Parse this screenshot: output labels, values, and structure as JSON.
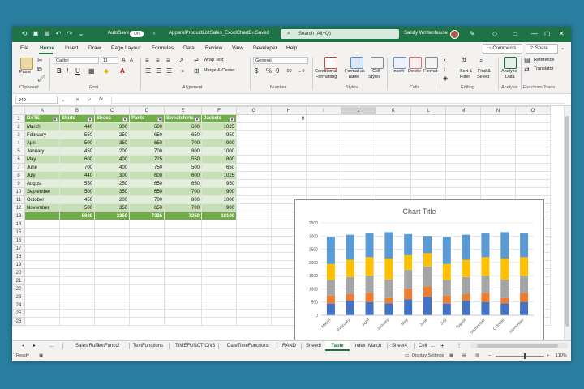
{
  "title_bar": {
    "autosave_label": "AutoSave",
    "autosave_state": "On",
    "doc_title": "ApparelProductListSales_ExcelChartD...",
    "saved_state": "• Saved",
    "search_placeholder": "Search (Alt+Q)",
    "user_name": "Sandy Writtenhouse"
  },
  "menu": {
    "tabs": [
      "File",
      "Home",
      "Insert",
      "Draw",
      "Page Layout",
      "Formulas",
      "Data",
      "Review",
      "View",
      "Developer",
      "Help"
    ],
    "active": "Home",
    "comments_label": "Comments",
    "share_label": "Share"
  },
  "ribbon": {
    "paste": "Paste",
    "clipboard": "Clipboard",
    "font_name": "Calibri",
    "font_size": "11",
    "font_group": "Font",
    "wrap_text": "Wrap Text",
    "merge_center": "Merge & Center",
    "alignment_group": "Alignment",
    "number_format": "General",
    "dollar": "$",
    "percent": "%",
    "comma": "9",
    "dec_inc": ".00",
    "dec_dec": "→0",
    "number_group": "Number",
    "cond_formatting_1": "Conditional",
    "cond_formatting_2": "Formatting",
    "format_table_1": "Format as",
    "format_table_2": "Table",
    "cell_styles_1": "Cell",
    "cell_styles_2": "Styles",
    "styles_group": "Styles",
    "insert": "Insert",
    "delete": "Delete",
    "format": "Format",
    "cells_group": "Cells",
    "sort_filter_1": "Sort &",
    "sort_filter_2": "Filter",
    "find_select_1": "Find &",
    "find_select_2": "Select",
    "editing_group": "Editing",
    "analyze_data_1": "Analyze",
    "analyze_data_2": "Data",
    "analysis_group": "Analysis",
    "reference": "Reference",
    "translator": "Translator",
    "functions_group": "Functions Trans..."
  },
  "formula_bar": {
    "name_box": "J40",
    "cancel": "✕",
    "enter": "✓",
    "fx": "fx",
    "value": ""
  },
  "columns": [
    "A",
    "B",
    "C",
    "D",
    "E",
    "F",
    "G",
    "H",
    "I",
    "J",
    "K",
    "L",
    "M",
    "N",
    "O"
  ],
  "table": {
    "headers": [
      "DATE",
      "Shirts",
      "Shoes",
      "Pants",
      "Sweatshirts",
      "Jackets"
    ],
    "rows": [
      [
        "March",
        "440",
        "300",
        "600",
        "600",
        "1025"
      ],
      [
        "February",
        "550",
        "250",
        "650",
        "650",
        "950"
      ],
      [
        "April",
        "500",
        "350",
        "650",
        "700",
        "900"
      ],
      [
        "January",
        "450",
        "200",
        "700",
        "800",
        "1000"
      ],
      [
        "May",
        "600",
        "400",
        "725",
        "550",
        "800"
      ],
      [
        "June",
        "700",
        "400",
        "750",
        "500",
        "650"
      ],
      [
        "July",
        "440",
        "300",
        "600",
        "600",
        "1025"
      ],
      [
        "August",
        "550",
        "250",
        "650",
        "650",
        "950"
      ],
      [
        "September",
        "500",
        "350",
        "650",
        "700",
        "900"
      ],
      [
        "October",
        "450",
        "200",
        "700",
        "800",
        "1000"
      ],
      [
        "November",
        "500",
        "350",
        "650",
        "700",
        "900"
      ]
    ],
    "totals": [
      "",
      "5680",
      "3350",
      "7325",
      "7250",
      "10100"
    ]
  },
  "cell_h1": "0",
  "row_count": 26,
  "chart_data": {
    "type": "bar",
    "stacked": true,
    "title": "Chart Title",
    "categories": [
      "March",
      "February",
      "April",
      "January",
      "May",
      "June",
      "July",
      "August",
      "September",
      "October",
      "November"
    ],
    "series": [
      {
        "name": "Shirts",
        "color": "#4472c4",
        "values": [
          440,
          550,
          500,
          450,
          600,
          700,
          440,
          550,
          500,
          450,
          500
        ]
      },
      {
        "name": "Shoes",
        "color": "#ed7d31",
        "values": [
          300,
          250,
          350,
          200,
          400,
          400,
          300,
          250,
          350,
          200,
          350
        ]
      },
      {
        "name": "Pants",
        "color": "#a5a5a5",
        "values": [
          600,
          650,
          650,
          700,
          725,
          750,
          600,
          650,
          650,
          700,
          650
        ]
      },
      {
        "name": "Sweatshirts",
        "color": "#ffc000",
        "values": [
          600,
          650,
          700,
          800,
          550,
          500,
          600,
          650,
          700,
          800,
          700
        ]
      },
      {
        "name": "Jackets",
        "color": "#5b9bd5",
        "values": [
          1025,
          950,
          900,
          1000,
          800,
          650,
          1025,
          950,
          900,
          1000,
          900
        ]
      }
    ],
    "ylim": [
      0,
      3500
    ],
    "yticks": [
      0,
      500,
      1000,
      1500,
      2000,
      2500,
      3000,
      3500
    ],
    "legend": "bottom",
    "grid": true
  },
  "sheet_tabs": {
    "nav_prev": "◂",
    "nav_next": "▸",
    "ellipsis": "...",
    "tabs": [
      "Sales Rule",
      "TextFunct2",
      "TextFunctions",
      "TIMEFUNCTIONS",
      "DateTimeFunctions",
      "RAND",
      "Sheet6",
      "Table",
      "Index_Match",
      "Sheet4",
      "Cell"
    ],
    "active": "Table",
    "more": "...",
    "add": "+"
  },
  "status": {
    "ready": "Ready",
    "display_settings": "Display Settings",
    "zoom": "110%"
  },
  "colors": {
    "excel_green": "#1f7245",
    "background": "#2a7ea0",
    "table_header": "#70ad47"
  }
}
